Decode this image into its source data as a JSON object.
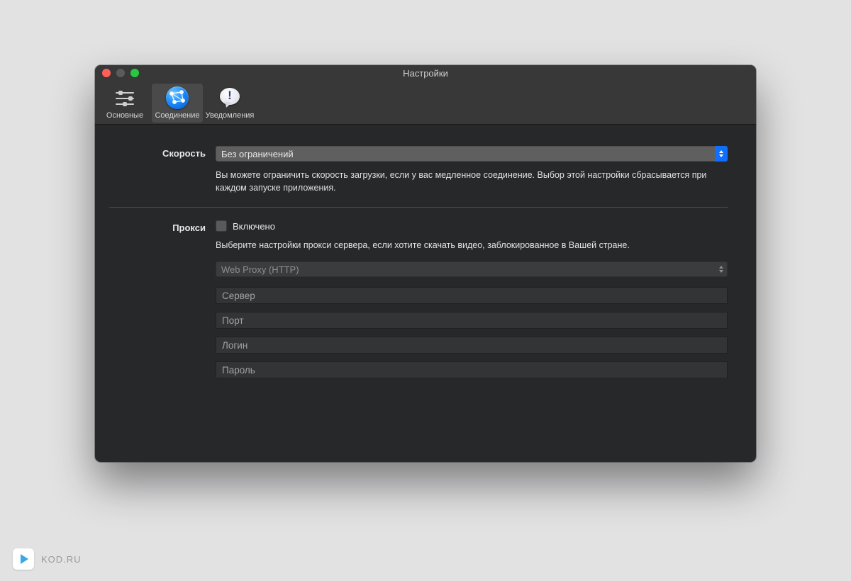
{
  "window": {
    "title": "Настройки"
  },
  "toolbar": {
    "items": [
      {
        "label": "Основные"
      },
      {
        "label": "Соединение"
      },
      {
        "label": "Уведомления"
      }
    ]
  },
  "speed": {
    "label": "Скорость",
    "selected": "Без ограничений",
    "hint": "Вы можете ограничить скорость загрузки, если у вас медленное соединение. Выбор этой настройки сбрасывается при каждом запуске приложения."
  },
  "proxy": {
    "label": "Прокси",
    "enabled_label": "Включено",
    "enabled": false,
    "hint": "Выберите настройки прокси сервера, если хотите скачать видео, заблокированное в Вашей стране.",
    "type_selected": "Web Proxy (HTTP)",
    "fields": {
      "server_placeholder": "Сервер",
      "port_placeholder": "Порт",
      "login_placeholder": "Логин",
      "password_placeholder": "Пароль"
    }
  },
  "watermark": {
    "text": "KOD.RU"
  }
}
